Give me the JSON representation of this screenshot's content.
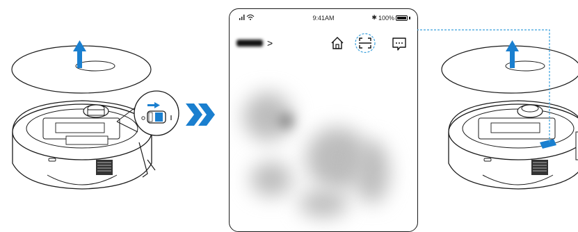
{
  "phone": {
    "status_time": "9:41AM",
    "battery_percent": "100%",
    "device_label": "HOME",
    "device_chevron": ">"
  },
  "icons": {
    "home": "home-icon",
    "scan": "scan-icon",
    "message": "message-icon",
    "arrows": "double-chevron-right-icon",
    "lift": "up-arrow-icon",
    "slide": "right-arrow-icon"
  },
  "colors": {
    "accent": "#1a7fcf",
    "line": "#1a1a1a",
    "dashed": "#3aa0dc"
  }
}
